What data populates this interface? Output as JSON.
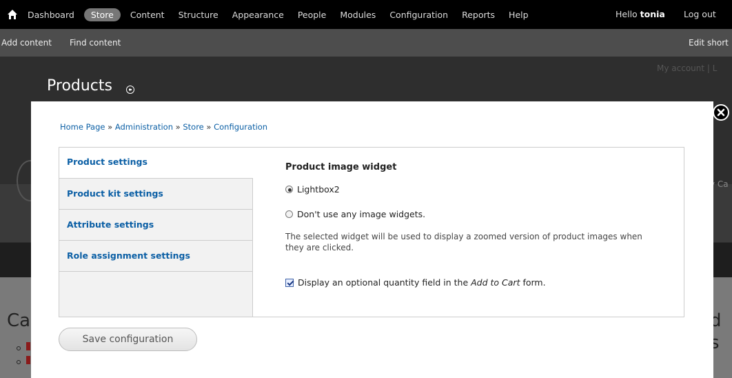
{
  "toolbar": {
    "menu": [
      "Dashboard",
      "Store",
      "Content",
      "Structure",
      "Appearance",
      "People",
      "Modules",
      "Configuration",
      "Reports",
      "Help"
    ],
    "active_item": "Store",
    "greeting": "Hello",
    "username": "tonia",
    "logout_label": "Log out"
  },
  "shortcuts": {
    "add_content": "Add content",
    "find_content": "Find content",
    "edit_shortcuts": "Edit short"
  },
  "background": {
    "account_link": "My account  |  L",
    "page_title": "Products",
    "left_heading": "Ca",
    "right_heading_1": "d",
    "right_heading_2": "s",
    "cart_fragment": "y Ca"
  },
  "modal": {
    "breadcrumb": [
      "Home Page",
      "Administration",
      "Store",
      "Configuration"
    ],
    "breadcrumb_sep": " » ",
    "tabs": [
      "Product settings",
      "Product kit settings",
      "Attribute settings",
      "Role assignment settings"
    ],
    "selected_tab": "Product settings",
    "widget_legend": "Product image widget",
    "options": [
      {
        "label": "Lightbox2",
        "checked": true
      },
      {
        "label": "Don't use any image widgets.",
        "checked": false
      }
    ],
    "description": "The selected widget will be used to display a zoomed version of product images when they are clicked.",
    "quantity_checkbox": {
      "prefix": "Display an optional quantity field in the ",
      "emphasis": "Add to Cart",
      "suffix": " form.",
      "checked": true
    },
    "save_label": "Save configuration"
  }
}
